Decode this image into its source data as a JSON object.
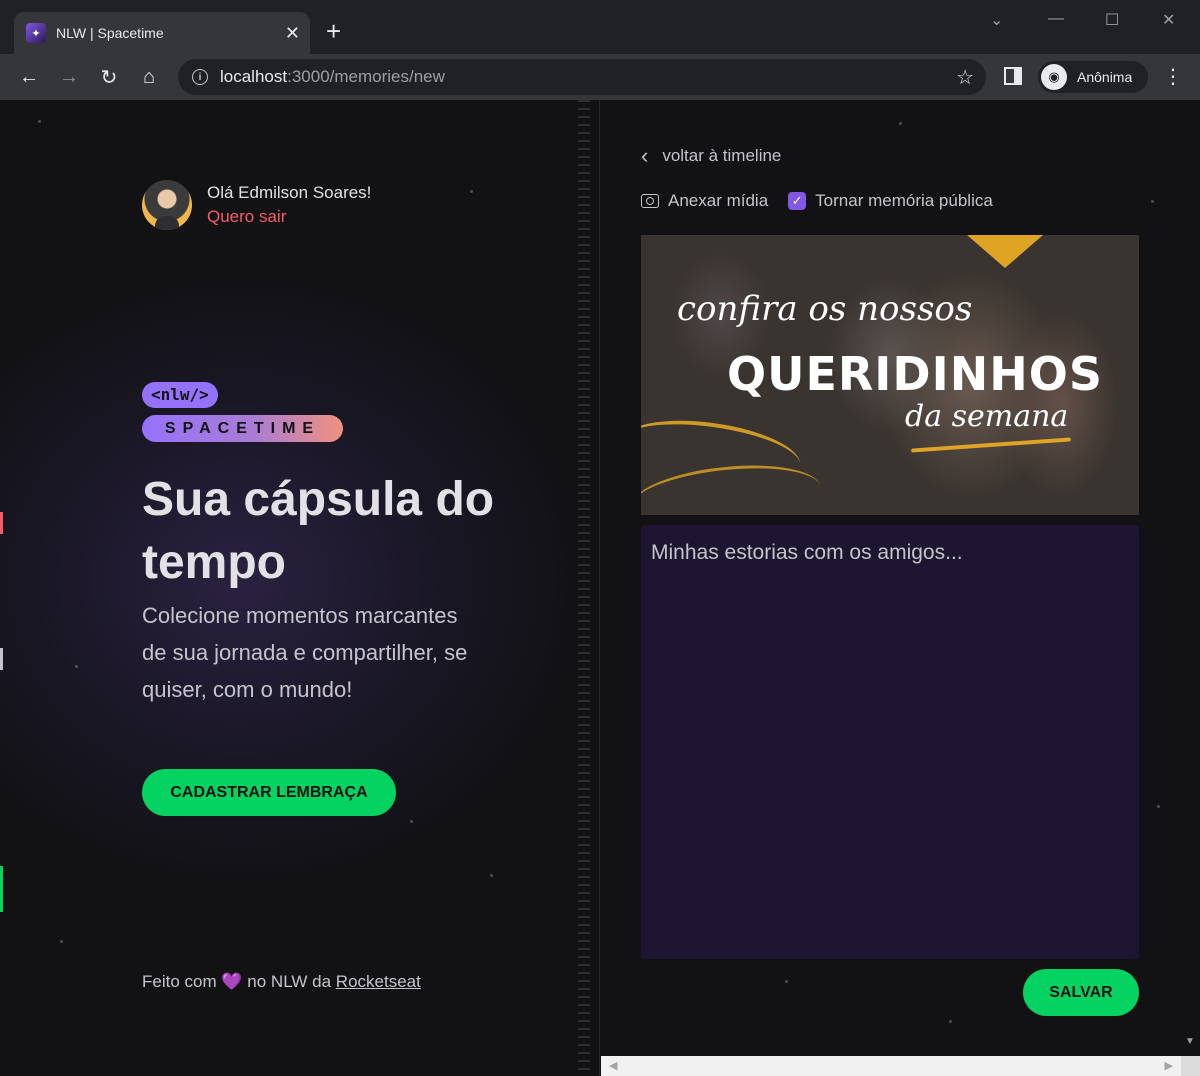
{
  "browser": {
    "tab_title": "NLW | Spacetime",
    "new_tab": "+",
    "url_host": "localhost",
    "url_path": ":3000/memories/new",
    "profile_label": "Anônima"
  },
  "user": {
    "greeting": "Olá Edmilson Soares!",
    "logout": "Quero sair"
  },
  "logo": {
    "top": "<nlw/>",
    "bottom": "SPACETIME"
  },
  "hero": {
    "title": "Sua cápsula do tempo",
    "description": "Colecione momentos marcantes de sua jornada e compartilher, se quiser, com o mundo!",
    "cta": "CADASTRAR LEMBRAÇA"
  },
  "footer": {
    "prefix": "Feito com",
    "middle": "no NLW da",
    "link": "Rocketseat"
  },
  "form": {
    "back": "voltar à timeline",
    "attach_media": "Anexar mídia",
    "public_label": "Tornar memória pública",
    "public_checked": true,
    "content_value": "Minhas estorias com os amigos...",
    "save": "SALVAR"
  },
  "preview": {
    "line1": "confira os nossos",
    "line2": "QUERIDINHOS",
    "line3": "da semana"
  },
  "colors": {
    "accent_green": "#04d361",
    "accent_purple": "#8257e5",
    "logout_red": "#f75a68",
    "gold": "#e0a425"
  }
}
